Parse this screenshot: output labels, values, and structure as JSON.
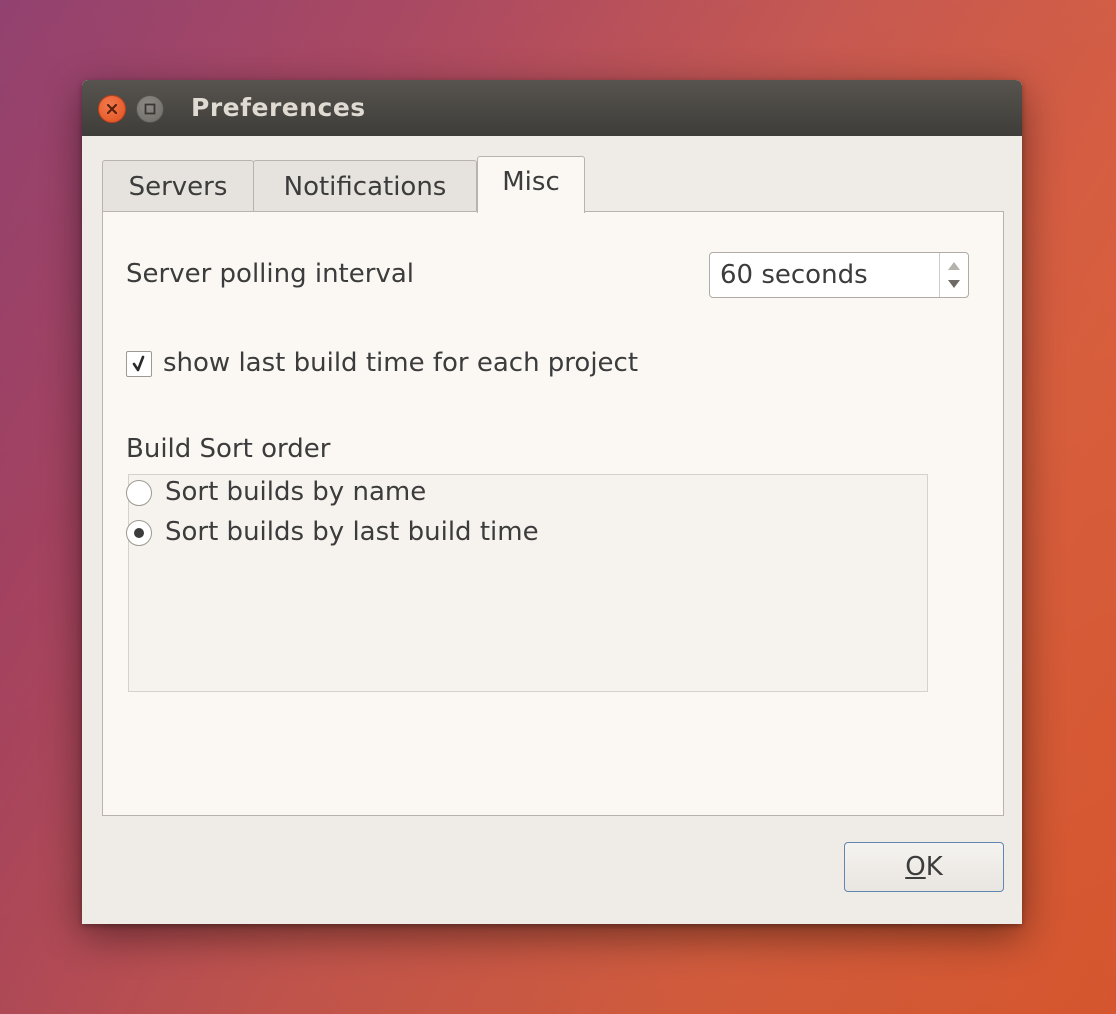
{
  "window": {
    "title": "Preferences"
  },
  "tabs": [
    {
      "label": "Servers",
      "active": false
    },
    {
      "label": "Notifications",
      "active": false
    },
    {
      "label": "Misc",
      "active": true
    }
  ],
  "misc": {
    "polling_label": "Server polling interval",
    "polling_value": "60 seconds",
    "show_build_time_label": "show last build time for each project",
    "show_build_time_checked": true,
    "sort_group_label": "Build Sort order",
    "sort_options": [
      {
        "label": "Sort builds by name",
        "selected": false
      },
      {
        "label": "Sort builds by last build time",
        "selected": true
      }
    ]
  },
  "buttons": {
    "ok_mnemonic": "O",
    "ok_rest": "K"
  },
  "colors": {
    "close_button": "#e0501f",
    "titlebar": "#3f3d39",
    "ok_border": "#5f87b0"
  }
}
